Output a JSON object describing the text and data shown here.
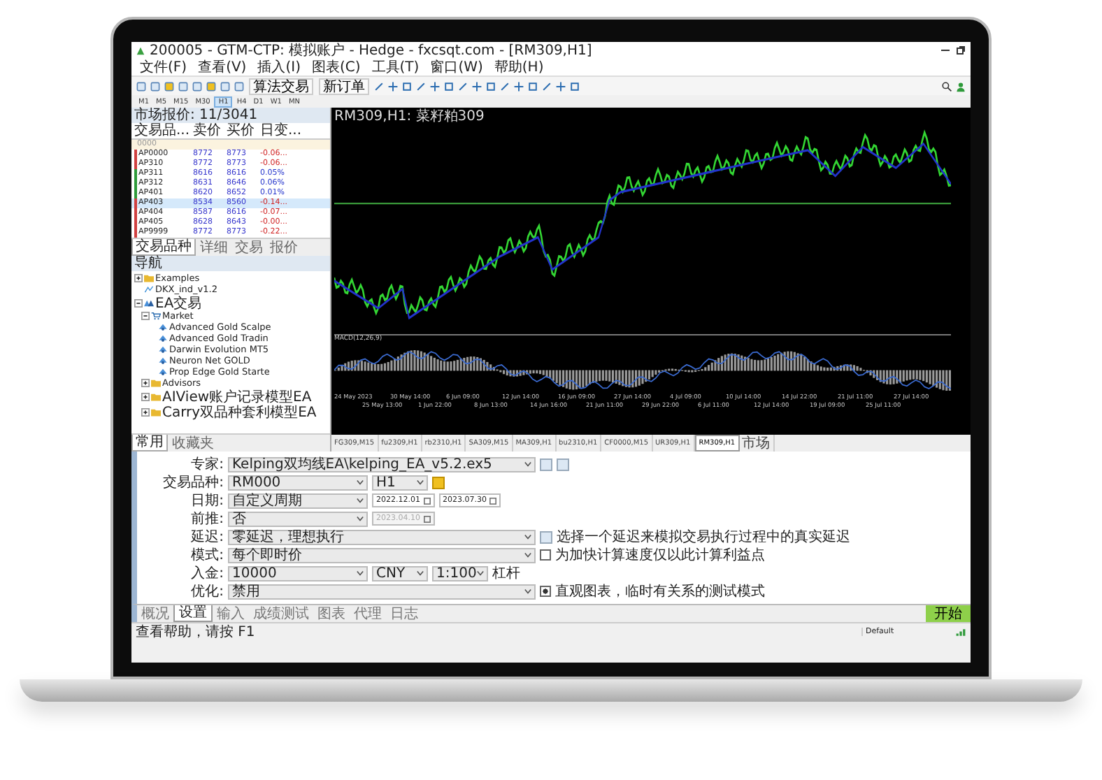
{
  "window": {
    "title": "200005 - GTM-CTP: 模拟账户 - Hedge - fxcsqt.com - [RM309,H1]"
  },
  "menu": [
    "文件(F)",
    "查看(V)",
    "插入(I)",
    "图表(C)",
    "工具(T)",
    "窗口(W)",
    "帮助(H)"
  ],
  "toolbar": {
    "buttons": [
      "算法交易",
      "新订单"
    ]
  },
  "timeframes": [
    {
      "label": "M1",
      "selected": false
    },
    {
      "label": "M5",
      "selected": false
    },
    {
      "label": "M15",
      "selected": false
    },
    {
      "label": "M30",
      "selected": false
    },
    {
      "label": "H1",
      "selected": true
    },
    {
      "label": "H4",
      "selected": false
    },
    {
      "label": "D1",
      "selected": false
    },
    {
      "label": "W1",
      "selected": false
    },
    {
      "label": "MN",
      "selected": false
    }
  ],
  "market_watch": {
    "title": "市场报价: 11/3041",
    "columns": [
      "交易品...",
      "卖价",
      "买价",
      "日变..."
    ],
    "rows": [
      {
        "kind": "group",
        "symbol": "0000",
        "selected": false
      },
      {
        "kind": "down",
        "symbol": "AP0000",
        "bid": "8772",
        "ask": "8773",
        "change": "-0.06...",
        "selected": false
      },
      {
        "kind": "down",
        "symbol": "AP310",
        "bid": "8772",
        "ask": "8773",
        "change": "-0.06...",
        "selected": false
      },
      {
        "kind": "up",
        "symbol": "AP311",
        "bid": "8616",
        "ask": "8616",
        "change": "0.05%",
        "selected": false
      },
      {
        "kind": "up",
        "symbol": "AP312",
        "bid": "8631",
        "ask": "8646",
        "change": "0.06%",
        "selected": false
      },
      {
        "kind": "up",
        "symbol": "AP401",
        "bid": "8620",
        "ask": "8652",
        "change": "0.01%",
        "selected": false
      },
      {
        "kind": "down",
        "symbol": "AP403",
        "bid": "8534",
        "ask": "8560",
        "change": "-0.14...",
        "selected": true
      },
      {
        "kind": "down",
        "symbol": "AP404",
        "bid": "8587",
        "ask": "8616",
        "change": "-0.07...",
        "selected": false
      },
      {
        "kind": "down",
        "symbol": "AP405",
        "bid": "8628",
        "ask": "8643",
        "change": "-0.00...",
        "selected": false
      },
      {
        "kind": "down",
        "symbol": "AP9999",
        "bid": "8772",
        "ask": "8773",
        "change": "-0.22...",
        "selected": false
      }
    ],
    "tabs": [
      {
        "label": "交易品种",
        "selected": true
      },
      {
        "label": "详细",
        "selected": false
      },
      {
        "label": "交易",
        "selected": false
      },
      {
        "label": "报价",
        "selected": false
      }
    ]
  },
  "navigator": {
    "title": "导航",
    "items": [
      {
        "kind": "folder",
        "label": "Examples",
        "expanded": false
      },
      {
        "kind": "script",
        "label": "DKX_ind_v1.2"
      },
      {
        "kind": "ea-group",
        "label": "EA交易",
        "expanded": true,
        "children": [
          {
            "kind": "market",
            "label": "Market",
            "expanded": true,
            "children": [
              {
                "kind": "ea",
                "label": "Advanced Gold Scalpe"
              },
              {
                "kind": "ea",
                "label": "Advanced Gold Tradin"
              },
              {
                "kind": "ea",
                "label": "Darwin Evolution MT5"
              },
              {
                "kind": "ea",
                "label": "Neuron Net GOLD"
              },
              {
                "kind": "ea",
                "label": "Prop Edge Gold Starte"
              }
            ]
          },
          {
            "kind": "folder",
            "label": "Advisors",
            "expanded": false
          },
          {
            "kind": "folder",
            "label": "AIView账户记录模型EA",
            "expanded": false
          },
          {
            "kind": "folder",
            "label": "Carry双品种套利模型EA",
            "expanded": false
          }
        ]
      }
    ],
    "tabs": [
      {
        "label": "常用",
        "selected": true
      },
      {
        "label": "收藏夹",
        "selected": false
      }
    ]
  },
  "chart": {
    "title": "RM309,H1: 菜籽粕309",
    "indicator_label": "MACD(12,26,9)",
    "time_labels": [
      "24 May 2023",
      "25 May 13:00",
      "30 May 14:00",
      "1 Jun 22:00",
      "6 Jun 09:00",
      "8 Jun 13:00",
      "12 Jun 14:00",
      "14 Jun 16:00",
      "16 Jun 09:00",
      "21 Jun 11:00",
      "27 Jun 14:00",
      "29 Jun 22:00",
      "4 Jul 09:00",
      "6 Jul 11:00",
      "10 Jul 14:00",
      "12 Jul 14:00",
      "14 Jul 22:00",
      "19 Jul 09:00",
      "21 Jul 11:00",
      "25 Jul 11:00",
      "27 Jul 14:00"
    ]
  },
  "chart_tabs": [
    {
      "label": "FG309,M15",
      "selected": false
    },
    {
      "label": "fu2309,H1",
      "selected": false
    },
    {
      "label": "rb2310,H1",
      "selected": false
    },
    {
      "label": "SA309,M15",
      "selected": false
    },
    {
      "label": "MA309,H1",
      "selected": false
    },
    {
      "label": "bu2310,H1",
      "selected": false
    },
    {
      "label": "CF0000,M15",
      "selected": false
    },
    {
      "label": "UR309,H1",
      "selected": false
    },
    {
      "label": "RM309,H1",
      "selected": true
    },
    {
      "label": "市场",
      "selected": false
    }
  ],
  "tester": {
    "rows": [
      {
        "label": "专家:",
        "controls": [
          {
            "kind": "select-wide",
            "value": "Kelping双均线EA\\kelping_EA_v5.2.ex5"
          },
          {
            "kind": "edit-button"
          },
          {
            "kind": "settings-button"
          }
        ]
      },
      {
        "label": "交易品种:",
        "controls": [
          {
            "kind": "select",
            "value": "RM000"
          },
          {
            "kind": "select-small",
            "value": "H1"
          },
          {
            "kind": "warning-button"
          }
        ]
      },
      {
        "label": "日期:",
        "controls": [
          {
            "kind": "select",
            "value": "自定义周期"
          },
          {
            "kind": "date",
            "value": "2022.12.01",
            "disabled": false
          },
          {
            "kind": "date",
            "value": "2023.07.30",
            "disabled": false
          }
        ]
      },
      {
        "label": "前推:",
        "controls": [
          {
            "kind": "select",
            "value": "否"
          },
          {
            "kind": "date",
            "value": "2023.04.10",
            "disabled": true
          }
        ]
      },
      {
        "label": "延迟:",
        "controls": [
          {
            "kind": "select-wide",
            "value": "零延迟，理想执行"
          },
          {
            "kind": "refresh-button"
          },
          {
            "kind": "text",
            "value": "选择一个延迟来模拟交易执行过程中的真实延迟"
          }
        ]
      },
      {
        "label": "模式:",
        "controls": [
          {
            "kind": "select-wide",
            "value": "每个即时价"
          },
          {
            "kind": "checkbox",
            "checked": false,
            "value": "为加快计算速度仅以此计算利益点"
          }
        ]
      },
      {
        "label": "入金:",
        "controls": [
          {
            "kind": "select",
            "value": "10000"
          },
          {
            "kind": "select-small",
            "value": "CNY"
          },
          {
            "kind": "select-small",
            "value": "1:100"
          },
          {
            "kind": "text",
            "value": "杠杆"
          }
        ]
      },
      {
        "label": "优化:",
        "controls": [
          {
            "kind": "select-wide",
            "value": "禁用"
          },
          {
            "kind": "checkbox",
            "checked": true,
            "value": "直观图表，临时有关系的测试模式"
          }
        ]
      }
    ],
    "tabs": [
      {
        "label": "概况",
        "selected": false
      },
      {
        "label": "设置",
        "selected": true
      },
      {
        "label": "输入",
        "selected": false
      },
      {
        "label": "成绩测试",
        "selected": false
      },
      {
        "label": "图表",
        "selected": false
      },
      {
        "label": "代理",
        "selected": false
      },
      {
        "label": "日志",
        "selected": false
      }
    ],
    "start_button": "开始"
  },
  "status_bar": {
    "help": "查看帮助，请按 F1",
    "profile": "Default"
  }
}
